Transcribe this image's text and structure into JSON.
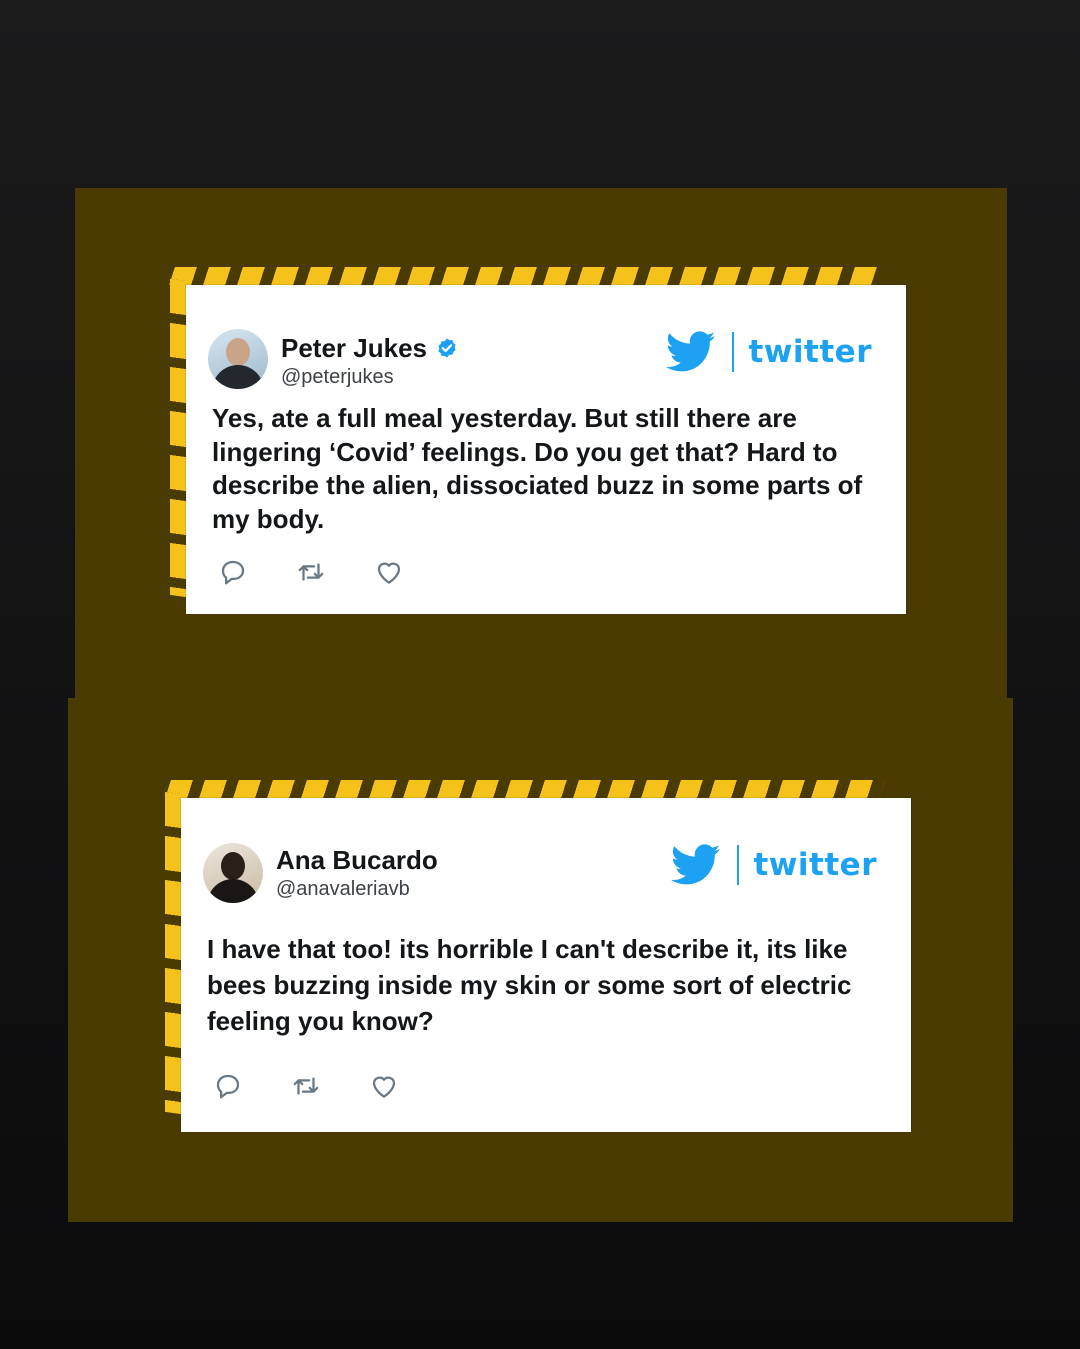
{
  "tweets": [
    {
      "author": "Peter Jukes",
      "handle": "@peterjukes",
      "verified": true,
      "text": "Yes, ate a full meal yesterday. But still there are lingering ‘Covid’ feelings. Do you get that? Hard to describe the alien, dissociated buzz in some parts of my body.",
      "brand": "twitter"
    },
    {
      "author": "Ana Bucardo",
      "handle": "@anavaleriavb",
      "verified": false,
      "text": "I have that too! its horrible I can't describe it, its like bees buzzing inside my skin or some sort of electric feeling you know?",
      "brand": "twitter"
    }
  ],
  "icons": {
    "reply": "reply-icon",
    "retweet": "retweet-icon",
    "like": "heart-icon",
    "verified": "verified-badge-icon",
    "brand": "twitter-bird-icon"
  },
  "colors": {
    "panel": "#4a3b03",
    "stripe": "#f4c21a",
    "twitter_blue": "#1da1f2",
    "background": "#121213"
  }
}
